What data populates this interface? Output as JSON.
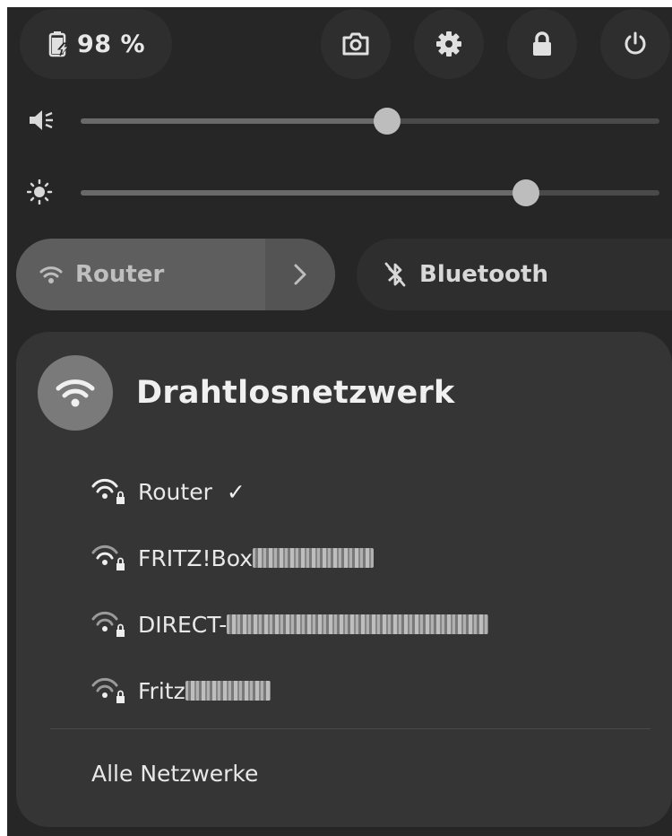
{
  "battery": {
    "label": "98 %",
    "icon": "battery-charging-icon"
  },
  "top_buttons": [
    {
      "name": "screenshot-button",
      "icon": "camera-icon"
    },
    {
      "name": "settings-button",
      "icon": "gear-icon"
    },
    {
      "name": "lock-button",
      "icon": "lock-icon"
    },
    {
      "name": "power-button",
      "icon": "power-icon"
    }
  ],
  "volume": {
    "icon": "speaker-muted-icon",
    "value": 0.53
  },
  "brightness": {
    "icon": "sun-icon",
    "value": 0.77
  },
  "wifi_toggle": {
    "label": "Router",
    "icon": "wifi-icon",
    "active": true
  },
  "bluetooth_toggle": {
    "label": "Bluetooth",
    "icon": "bluetooth-disabled-icon",
    "active": false
  },
  "wifi_menu": {
    "title": "Drahtlosnetzwerk",
    "networks": [
      {
        "ssid": "Router",
        "connected": true,
        "check": "✓",
        "secured": true
      },
      {
        "ssid": "FRITZ!Box",
        "connected": false,
        "secured": true
      },
      {
        "ssid": "DIRECT-",
        "connected": false,
        "secured": true
      },
      {
        "ssid": "Fritz",
        "connected": false,
        "secured": true
      }
    ],
    "all_networks_label": "Alle Netzwerke"
  },
  "colors": {
    "panel": "#262626",
    "menu": "#353535",
    "active_toggle": "#5e5e5e"
  }
}
